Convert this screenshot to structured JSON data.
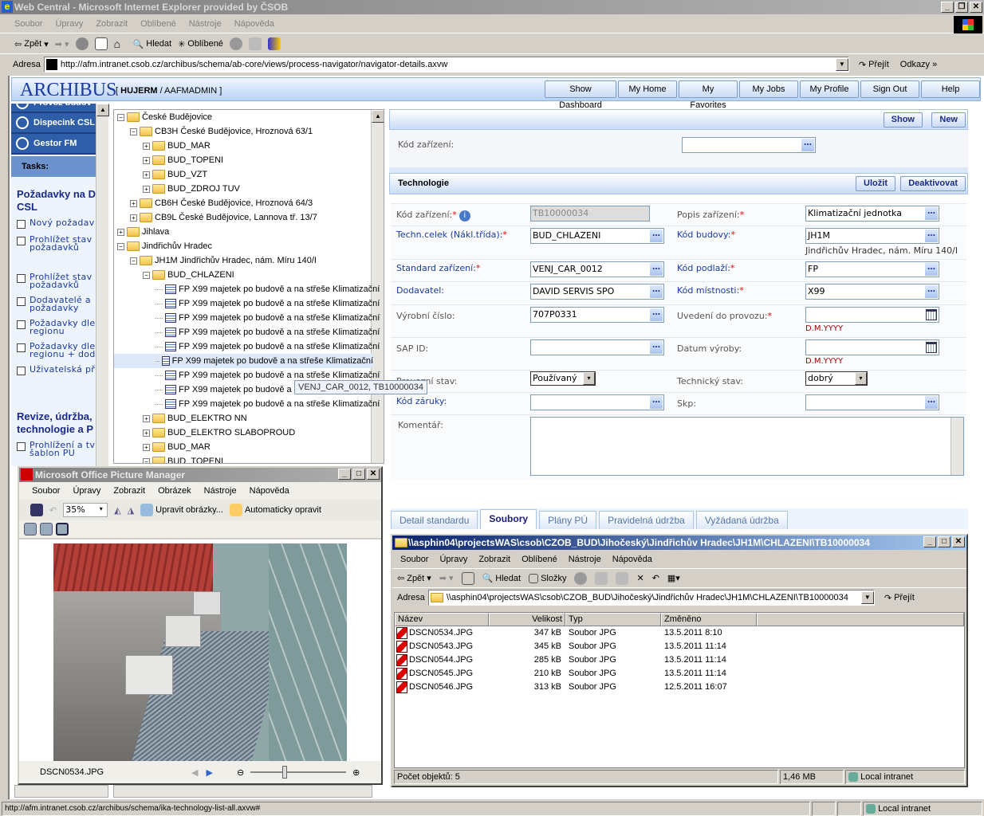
{
  "browser": {
    "title": "Web Central - Microsoft Internet Explorer provided by ČSOB",
    "menu": [
      "Soubor",
      "Úpravy",
      "Zobrazit",
      "Oblíbené",
      "Nástroje",
      "Nápověda"
    ],
    "toolbar": {
      "back": "Zpět",
      "search": "Hledat",
      "favorites": "Oblíbené"
    },
    "address_label": "Adresa",
    "address": "http://afm.intranet.csob.cz/archibus/schema/ab-core/views/process-navigator/navigator-details.axvw",
    "go": "Přejít",
    "links": "Odkazy",
    "status_url": "http://afm.intranet.csob.cz/archibus/schema/ika-technology-list-all.axvw#",
    "status_zone": "Local intranet"
  },
  "app": {
    "logo": "ARCHIBUS",
    "user_bold": "HUJERM",
    "user_role": "AAFMADMIN",
    "nav_buttons": [
      "Show Dashboard",
      "My Home",
      "My Favorites",
      "My Jobs",
      "My Profile",
      "Sign Out",
      "Help"
    ]
  },
  "leftnav": {
    "groups": [
      "Provoz budov",
      "Dispecink CSL",
      "Gestor FM"
    ],
    "tasks_label": "Tasks:",
    "sections": [
      {
        "title": "Požadavky na D CSL",
        "items": [
          "Nový požadav",
          "Prohlížet stav požadavků",
          "Prohlížet stav požadavků",
          "Dodavatelé a požadavky",
          "Požadavky dle regionu",
          "Požadavky dle regionu + dod",
          "Uživatelská př"
        ]
      },
      {
        "title": "Revize, údržba, technologie a P",
        "items": [
          "Prohlížení a tv šablon PU"
        ]
      }
    ]
  },
  "tree": {
    "nodes": [
      {
        "level": 0,
        "type": "folder",
        "exp": "-",
        "label": "České Budějovice"
      },
      {
        "level": 1,
        "type": "folder",
        "exp": "-",
        "label": "CB3H České Budějovice, Hroznová 63/1"
      },
      {
        "level": 2,
        "type": "folder",
        "exp": "+",
        "label": "BUD_MAR"
      },
      {
        "level": 2,
        "type": "folder",
        "exp": "+",
        "label": "BUD_TOPENI"
      },
      {
        "level": 2,
        "type": "folder",
        "exp": "+",
        "label": "BUD_VZT"
      },
      {
        "level": 2,
        "type": "folder",
        "exp": "+",
        "label": "BUD_ZDROJ TUV"
      },
      {
        "level": 1,
        "type": "folder",
        "exp": "+",
        "label": "CB6H České Budějovice, Hroznová 64/3"
      },
      {
        "level": 1,
        "type": "folder",
        "exp": "+",
        "label": "CB9L České Budějovice, Lannova tř. 13/7"
      },
      {
        "level": 0,
        "type": "folder",
        "exp": "+",
        "label": "Jihlava"
      },
      {
        "level": 0,
        "type": "folder",
        "exp": "-",
        "label": "Jindřichův Hradec"
      },
      {
        "level": 1,
        "type": "folder",
        "exp": "-",
        "label": "JH1M Jindřichův Hradec, nám. Míru 140/I"
      },
      {
        "level": 2,
        "type": "folder",
        "exp": "-",
        "label": "BUD_CHLAZENI"
      },
      {
        "level": 3,
        "type": "doc",
        "label": "FP X99 majetek po budově a na střeše Klimatizační"
      },
      {
        "level": 3,
        "type": "doc",
        "label": "FP X99 majetek po budově a na střeše Klimatizační"
      },
      {
        "level": 3,
        "type": "doc",
        "label": "FP X99 majetek po budově a na střeše Klimatizační"
      },
      {
        "level": 3,
        "type": "doc",
        "label": "FP X99 majetek po budově a na střeše Klimatizační"
      },
      {
        "level": 3,
        "type": "doc",
        "label": "FP X99 majetek po budově a na střeše Klimatizační"
      },
      {
        "level": 3,
        "type": "doc",
        "label": "FP X99 majetek po budově a na střeše Klimatizační",
        "selected": true
      },
      {
        "level": 3,
        "type": "doc",
        "label": "FP X99 majetek po budově a na střeše Klimatizační"
      },
      {
        "level": 3,
        "type": "doc",
        "label": "FP X99 majetek po budově a na"
      },
      {
        "level": 3,
        "type": "doc",
        "label": "FP X99 majetek po budově a na střeše Klimatizační"
      },
      {
        "level": 2,
        "type": "folder",
        "exp": "+",
        "label": "BUD_ELEKTRO NN"
      },
      {
        "level": 2,
        "type": "folder",
        "exp": "+",
        "label": "BUD_ELEKTRO SLABOPROUD"
      },
      {
        "level": 2,
        "type": "folder",
        "exp": "+",
        "label": "BUD_MAR"
      },
      {
        "level": 2,
        "type": "folder",
        "exp": "-",
        "label": "BUD_TOPENI"
      }
    ],
    "tooltip": "VENJ_CAR_0012, TB10000034"
  },
  "filter": {
    "show": "Show",
    "new": "New",
    "label": "Kód zařízení:",
    "value": ""
  },
  "form": {
    "title": "Technologie",
    "save": "Uložit",
    "deactivate": "Deaktivovat",
    "rows": [
      [
        {
          "label": "Kód zařízení:",
          "req": true,
          "info": true,
          "value": "TB10000034",
          "type": "ro"
        },
        {
          "label": "Popis zařízení:",
          "req": true,
          "value": "Klimatizační jednotka",
          "type": "text"
        }
      ],
      [
        {
          "label": "Techn.celek (Nákl.třída):",
          "req": true,
          "link": true,
          "value": "BUD_CHLAZENI",
          "type": "text"
        },
        {
          "label": "Kód budovy:",
          "req": true,
          "link": true,
          "value": "JH1M",
          "type": "text",
          "hint": "Jindřichův Hradec, nám. Míru 140/I",
          "hintcolor": "#333"
        }
      ],
      [
        {
          "label": "Standard zařízení:",
          "req": true,
          "link": true,
          "value": "VENJ_CAR_0012",
          "type": "text"
        },
        {
          "label": "Kód podlaží:",
          "req": true,
          "link": true,
          "value": "FP",
          "type": "text"
        }
      ],
      [
        {
          "label": "Dodavatel:",
          "link": true,
          "value": "DAVID SERVIS SPO",
          "type": "text"
        },
        {
          "label": "Kód místnosti:",
          "req": true,
          "link": true,
          "value": "X99",
          "type": "text"
        }
      ],
      [
        {
          "label": "Výrobní číslo:",
          "value": "707P0331",
          "type": "text"
        },
        {
          "label": "Uvedení do provozu:",
          "req": true,
          "value": "",
          "type": "date",
          "hint": "D.M.YYYY"
        }
      ],
      [
        {
          "label": "SAP ID:",
          "value": "",
          "type": "text"
        },
        {
          "label": "Datum výroby:",
          "value": "",
          "type": "date",
          "hint": "D.M.YYYY"
        }
      ],
      [
        {
          "label": "Provozní stav:",
          "value": "Používaný",
          "type": "select"
        },
        {
          "label": "Technický stav:",
          "value": "dobrý",
          "type": "select"
        }
      ],
      [
        {
          "label": "Kód záruky:",
          "link": true,
          "value": "",
          "type": "text"
        },
        {
          "label": "Skp:",
          "value": "",
          "type": "text"
        }
      ]
    ],
    "comment_label": "Komentář:",
    "comment": ""
  },
  "tabs": [
    {
      "label": "Detail standardu"
    },
    {
      "label": "Soubory",
      "active": true
    },
    {
      "label": "Plány PÚ"
    },
    {
      "label": "Pravidelná údržba"
    },
    {
      "label": "Vyžádaná údržba"
    }
  ],
  "picmgr": {
    "title": "Microsoft Office Picture Manager",
    "menu": [
      "Soubor",
      "Úpravy",
      "Zobrazit",
      "Obrázek",
      "Nástroje",
      "Nápověda"
    ],
    "zoom": "35%",
    "edit": "Upravit obrázky...",
    "autofix": "Automaticky opravit",
    "filename": "DSCN0534.JPG",
    "zoom_slider": 0.35
  },
  "explorer": {
    "title": "\\\\asphin04\\projectsWAS\\csob\\CZOB_BUD\\Jihočeský\\Jindřichův Hradec\\JH1M\\CHLAZENI\\TB10000034",
    "menu": [
      "Soubor",
      "Úpravy",
      "Zobrazit",
      "Oblíbené",
      "Nástroje",
      "Nápověda"
    ],
    "toolbar": {
      "back": "Zpět",
      "search": "Hledat",
      "folders": "Složky"
    },
    "address_label": "Adresa",
    "address": "\\\\asphin04\\projectsWAS\\csob\\CZOB_BUD\\Jihočeský\\Jindřichův Hradec\\JH1M\\CHLAZENI\\TB10000034",
    "go": "Přejít",
    "columns": [
      "Název",
      "Velikost",
      "Typ",
      "Změněno"
    ],
    "files": [
      [
        "DSCN0534.JPG",
        "347 kB",
        "Soubor JPG",
        "13.5.2011 8:10"
      ],
      [
        "DSCN0543.JPG",
        "345 kB",
        "Soubor JPG",
        "13.5.2011 11:14"
      ],
      [
        "DSCN0544.JPG",
        "285 kB",
        "Soubor JPG",
        "13.5.2011 11:14"
      ],
      [
        "DSCN0545.JPG",
        "210 kB",
        "Soubor JPG",
        "13.5.2011 11:14"
      ],
      [
        "DSCN0546.JPG",
        "313 kB",
        "Soubor JPG",
        "12.5.2011 16:07"
      ]
    ],
    "status_count": "Počet objektů: 5",
    "status_size": "1,46 MB",
    "status_zone": "Local intranet"
  },
  "colors": {
    "accent": "#2f5ea8",
    "link": "#1a3aa0",
    "required": "#ee0000",
    "active_title": "#0a246a"
  }
}
